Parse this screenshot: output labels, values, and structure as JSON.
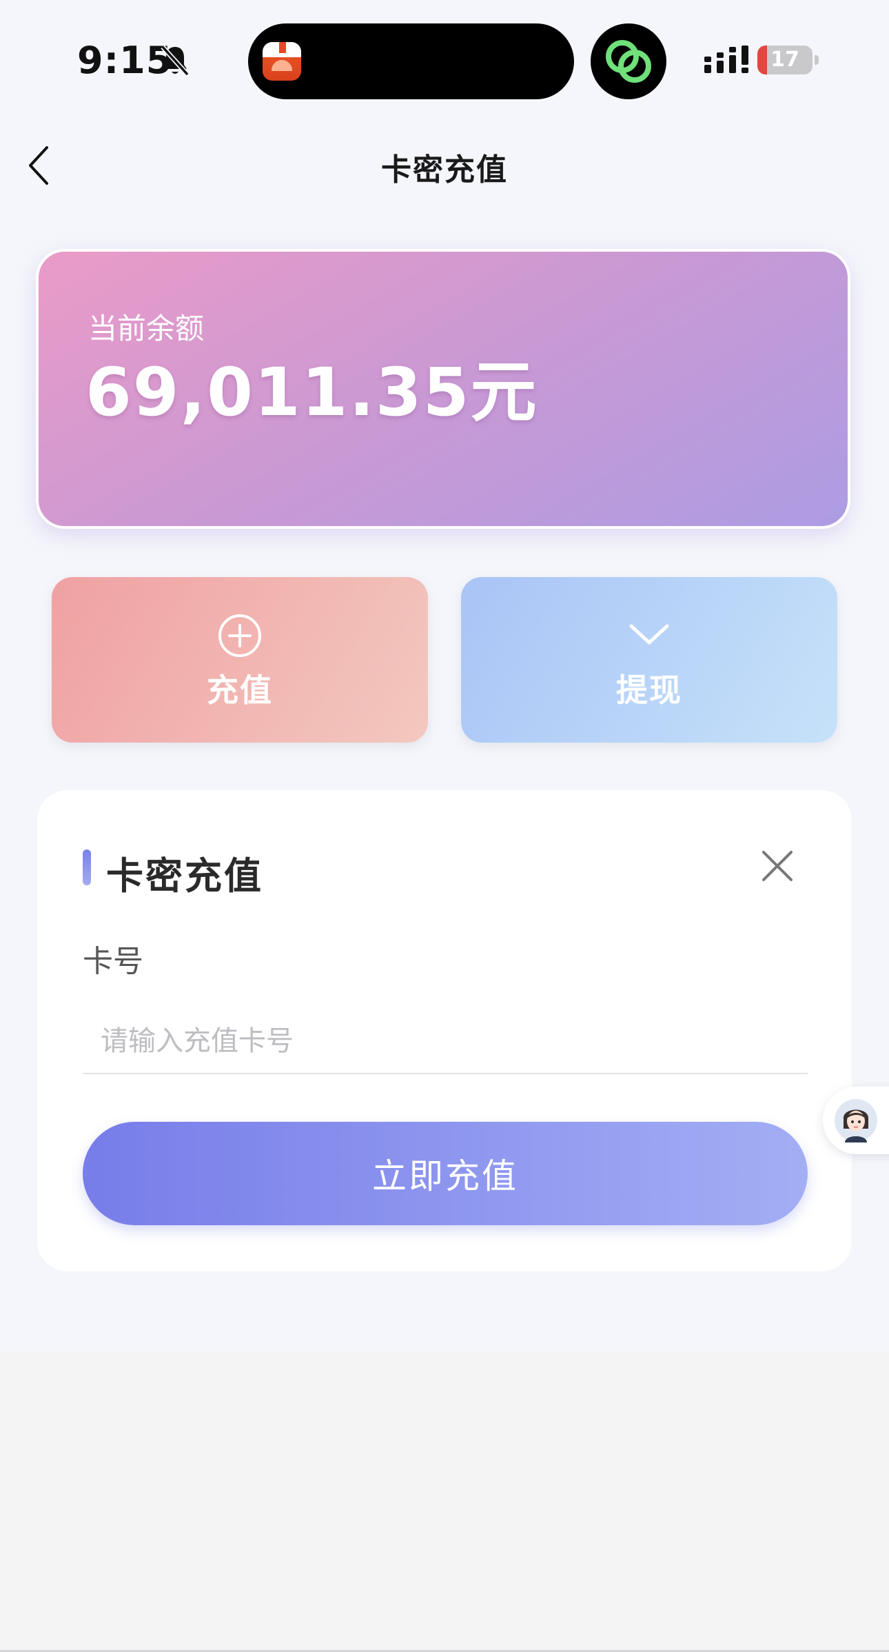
{
  "status_bar": {
    "time": "9:15",
    "battery_level": "17",
    "battery_fraction": 0.17
  },
  "nav": {
    "title": "卡密充值"
  },
  "balance": {
    "label": "当前余额",
    "amount": "69,011.35元"
  },
  "actions": {
    "recharge_label": "充值",
    "withdraw_label": "提现"
  },
  "form": {
    "title": "卡密充值",
    "card_label": "卡号",
    "card_placeholder": "请输入充值卡号",
    "card_value": "",
    "submit_label": "立即充值"
  },
  "colors": {
    "accent": "#7a80ea",
    "balance_gradient_start": "#ea9bc7",
    "balance_gradient_end": "#ad9ce3",
    "recharge_start": "#f0a1a2",
    "withdraw_start": "#a9c4f6"
  },
  "icons": {
    "back": "chevron-left-icon",
    "recharge": "plus-circle-icon",
    "withdraw": "chevron-down-icon",
    "close": "close-icon",
    "support": "support-avatar-icon",
    "bell_off": "bell-off-icon",
    "link": "link-icon"
  }
}
